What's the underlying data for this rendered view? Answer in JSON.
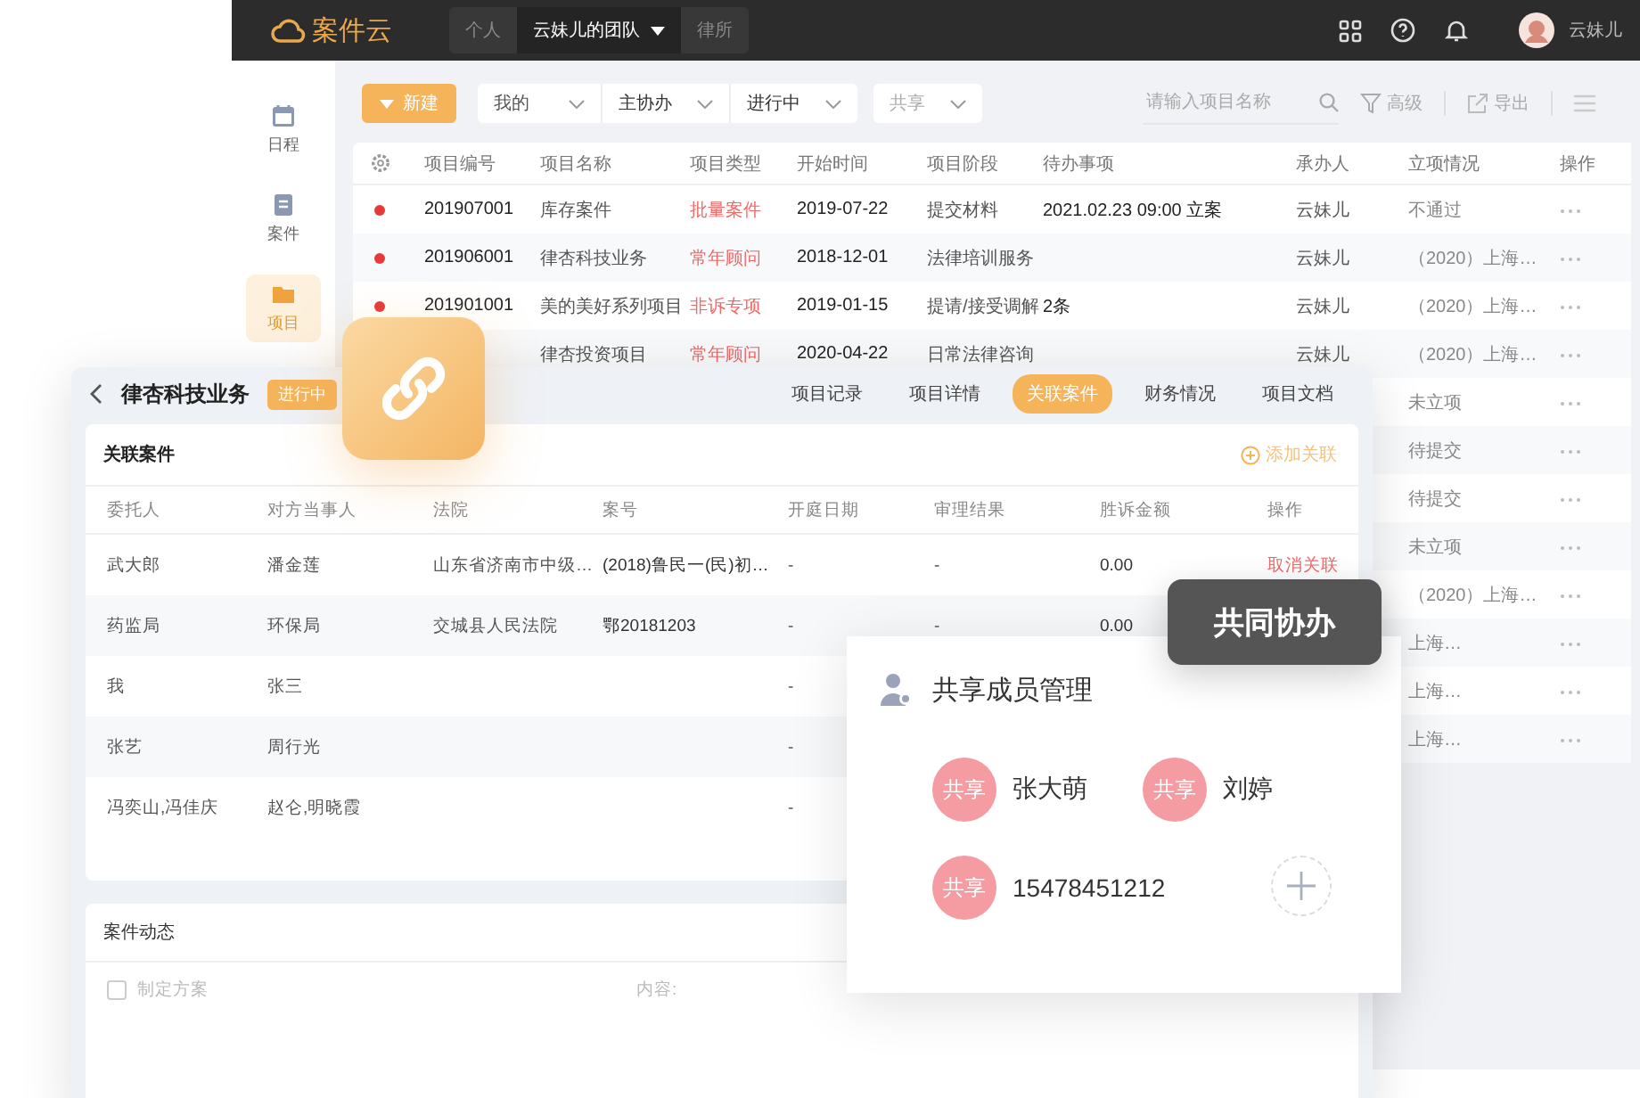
{
  "topbar": {
    "logo": "案件云",
    "scopes": [
      {
        "label": "个人",
        "selected": false
      },
      {
        "label": "云妹儿的团队",
        "selected": true
      },
      {
        "label": "律所",
        "selected": false
      }
    ],
    "user": "云妹儿"
  },
  "sidebar": [
    {
      "label": "日程",
      "selected": false
    },
    {
      "label": "案件",
      "selected": false
    },
    {
      "label": "项目",
      "selected": true
    }
  ],
  "toolbar": {
    "new_button": "新建",
    "filters": [
      "我的",
      "主协办",
      "进行中"
    ],
    "share_filter": {
      "placeholder": "共享"
    },
    "search": {
      "placeholder": "请输入项目名称"
    },
    "advanced": "高级",
    "export": "导出"
  },
  "projects": {
    "columns": [
      "项目编号",
      "项目名称",
      "项目类型",
      "开始时间",
      "项目阶段",
      "待办事项",
      "承办人",
      "立项情况",
      "操作"
    ],
    "rows": [
      {
        "urgent": true,
        "number": "201907001",
        "name": "库存案件",
        "type": "批量案件",
        "start": "2019-07-22",
        "stage": "提交材料",
        "todo": "2021.02.23 09:00 立案",
        "owner": "云妹儿",
        "status": "不通过"
      },
      {
        "urgent": true,
        "number": "201906001",
        "name": "律杏科技业务",
        "type": "常年顾问",
        "start": "2018-12-01",
        "stage": "法律培训服务",
        "owner": "云妹儿",
        "status": "（2020）上海…"
      },
      {
        "urgent": true,
        "number": "201901001",
        "name": "美的美好系列项目",
        "type": "非诉专项",
        "start": "2019-01-15",
        "stage": "提请/接受调解",
        "todo": "2条",
        "owner": "云妹儿",
        "status": "（2020）上海…"
      },
      {
        "name": "律杏投资项目",
        "type": "常年顾问",
        "start": "2020-04-22",
        "stage": "日常法律咨询",
        "owner": "云妹儿",
        "status": "（2020）上海…"
      },
      {
        "status": "未立项"
      },
      {
        "status": "待提交"
      },
      {
        "status": "待提交"
      },
      {
        "status": "未立项"
      },
      {
        "status": "（2020）上海…"
      },
      {
        "status": "上海…"
      },
      {
        "status": "上海…"
      },
      {
        "status": "上海…"
      }
    ]
  },
  "detail": {
    "title": "律杏科技业务",
    "status": "进行中",
    "tabs": [
      {
        "label": "项目记录",
        "selected": false
      },
      {
        "label": "项目详情",
        "selected": false
      },
      {
        "label": "关联案件",
        "selected": true
      },
      {
        "label": "财务情况",
        "selected": false
      },
      {
        "label": "项目文档",
        "selected": false
      }
    ],
    "related": {
      "title": "关联案件",
      "add": "添加关联",
      "columns": [
        "委托人",
        "对方当事人",
        "法院",
        "案号",
        "开庭日期",
        "审理结果",
        "胜诉金额",
        "操作"
      ],
      "rows": [
        {
          "client": "武大郎",
          "opponent": "潘金莲",
          "court": "山东省济南市中级…",
          "case_no": "(2018)鲁民一(民)初…",
          "hearing": "-",
          "result": "-",
          "amount": "0.00",
          "action": "取消关联"
        },
        {
          "client": "药监局",
          "opponent": "环保局",
          "court": "交城县人民法院",
          "case_no": "鄂20181203",
          "hearing": "-",
          "result": "-",
          "amount": "0.00"
        },
        {
          "client": "我",
          "opponent": "张三",
          "hearing": "-"
        },
        {
          "client": "张艺",
          "opponent": "周行光",
          "hearing": "-"
        },
        {
          "client": "冯奕山,冯佳庆",
          "opponent": "赵仑,明晓霞",
          "hearing": "-"
        }
      ]
    },
    "activity": {
      "title": "案件动态",
      "items": [
        {
          "label": "制定方案",
          "checked": false,
          "content_label": "内容:"
        }
      ]
    }
  },
  "share": {
    "tooltip": "共同协办",
    "title": "共享成员管理",
    "members": [
      {
        "badge": "共享",
        "name": "张大萌"
      },
      {
        "badge": "共享",
        "name": "刘婷"
      },
      {
        "badge": "共享",
        "name": "15478451212"
      }
    ]
  }
}
